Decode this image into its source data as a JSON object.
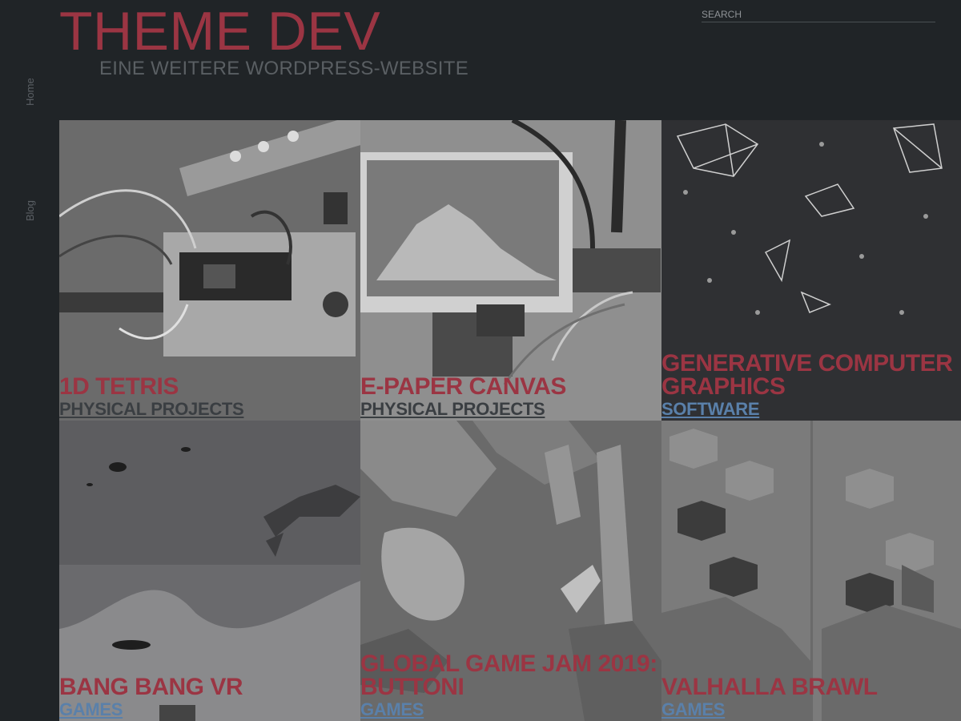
{
  "header": {
    "title": "THEME DEV",
    "tagline": "EINE WEITERE WORDPRESS-WEBSITE"
  },
  "search": {
    "placeholder": "SEARCH"
  },
  "nav": {
    "items": [
      {
        "label": "Home"
      },
      {
        "label": "Blog"
      }
    ]
  },
  "posts": [
    {
      "title": "1D TETRIS",
      "category": "PHYSICAL PROJECTS"
    },
    {
      "title": "E-PAPER CANVAS",
      "category": "PHYSICAL PROJECTS"
    },
    {
      "title": "GENERATIVE COMPUTER GRAPHICS",
      "category": "SOFTWARE"
    },
    {
      "title": "BANG BANG VR",
      "category": "GAMES"
    },
    {
      "title": "GLOBAL GAME JAM 2019: BUTTONI",
      "category": "GAMES"
    },
    {
      "title": "VALHALLA BRAWL",
      "category": "GAMES"
    }
  ],
  "colors": {
    "background": "#202427",
    "title": "#9b3543",
    "category_dark": "#3a3e42",
    "category_blue": "#5a80aa"
  }
}
